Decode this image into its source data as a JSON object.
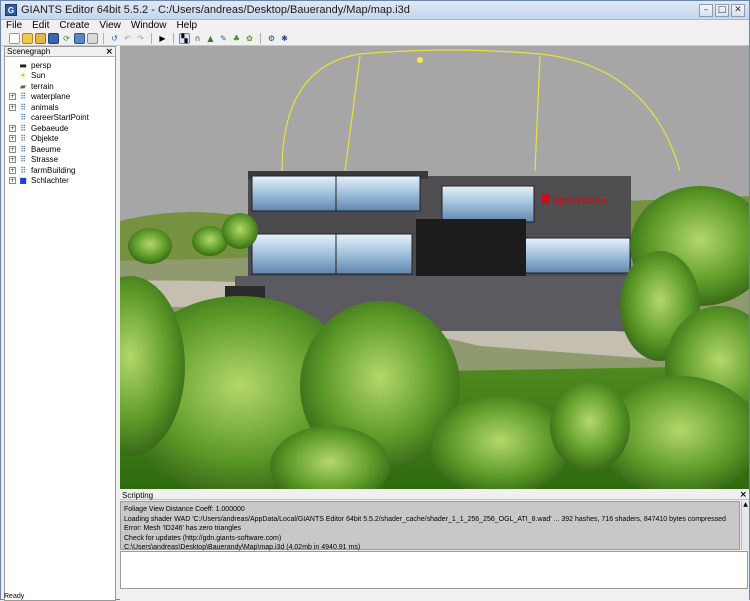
{
  "window": {
    "title": "GIANTS Editor 64bit 5.5.2 - C:/Users/andreas/Desktop/Bauerandy/Map/map.i3d",
    "controls": [
      "minimize",
      "maximize",
      "close"
    ]
  },
  "menu": [
    "File",
    "Edit",
    "Create",
    "View",
    "Window",
    "Help"
  ],
  "toolbar": {
    "buttons": [
      "new-icon",
      "open-icon",
      "import-icon",
      "save-icon",
      "reload-icon",
      "save-as-icon",
      "export-icon",
      "clear-icon",
      "undo-icon",
      "redo-icon",
      "play-icon",
      "select-icon",
      "move-icon",
      "terrain-sculpt-icon",
      "paint-icon",
      "foliage-icon",
      "decal-icon",
      "settings-icon",
      "render-icon"
    ]
  },
  "scenegraph": {
    "title": "Scenegraph",
    "close": "×",
    "items": [
      {
        "label": "persp",
        "icon": "camera-icon",
        "expandable": false
      },
      {
        "label": "Sun",
        "icon": "light-icon",
        "expandable": false
      },
      {
        "label": "terrain",
        "icon": "terrain-icon",
        "expandable": false
      },
      {
        "label": "waterplane",
        "icon": "transform-group-icon",
        "expandable": true
      },
      {
        "label": "animals",
        "icon": "transform-group-icon",
        "expandable": true
      },
      {
        "label": "careerStartPoint",
        "icon": "transform-group-icon",
        "expandable": false
      },
      {
        "label": "Gebaeude",
        "icon": "transform-group-icon",
        "expandable": true
      },
      {
        "label": "Objekte",
        "icon": "transform-group-icon",
        "expandable": true
      },
      {
        "label": "Baeume",
        "icon": "transform-group-icon",
        "expandable": true
      },
      {
        "label": "Strasse",
        "icon": "transform-group-icon",
        "expandable": true
      },
      {
        "label": "farmBuilding",
        "icon": "transform-group-icon",
        "expandable": true
      },
      {
        "label": "Schlachter",
        "icon": "shape-icon",
        "expandable": true
      }
    ]
  },
  "viewport": {
    "sign_text": "Sparkasse",
    "sky_color": "#a6a6a6",
    "accent_red": "#c0141c"
  },
  "scripting": {
    "title": "Scripting",
    "close": "×",
    "log": [
      "Foliage View Distance Coeff: 1.000000",
      "Loading shader WAD 'C:/Users/andreas/AppData/Local/GIANTS Editor 64bit 5.5.2/shader_cache/shader_1_1_256_256_OGL_ATI_8.wad' ... 392 hashes, 716 shaders, 847410 bytes compressed",
      "Error: Mesh 'ID246' has zero triangles",
      "Check for updates (http://gdn.giants-software.com)",
      "C:\\Users\\andreas\\Desktop\\Bauerandy\\Map\\map.i3d (4.02mb in 4940.91 ms)"
    ]
  },
  "status": {
    "text": "Ready"
  }
}
